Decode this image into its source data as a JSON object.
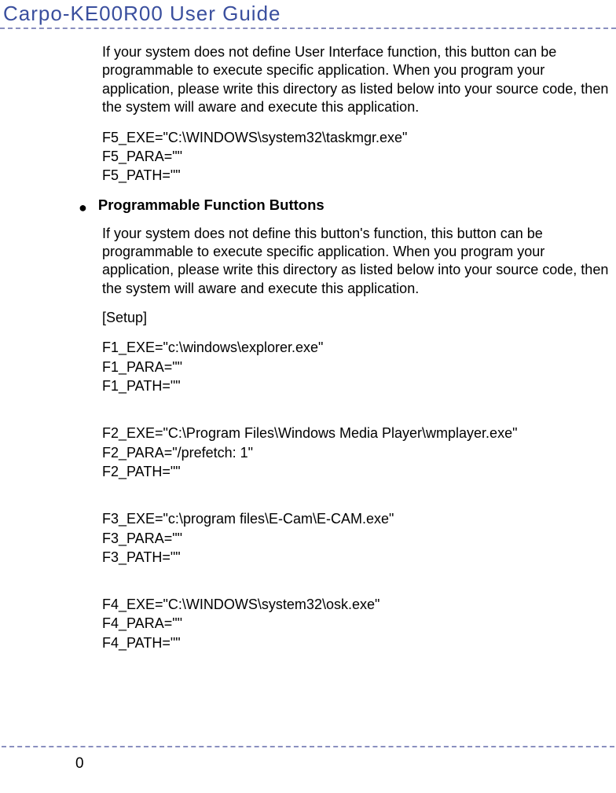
{
  "title": "Carpo-KE00R00  User  Guide",
  "intro_para": "If your system does not define User Interface function, this button can be programmable to execute specific application. When you program your application, please write this directory as listed below into your source code, then the system will aware and execute this application.",
  "f5": {
    "exe": "F5_EXE=\"C:\\WINDOWS\\system32\\taskmgr.exe\"",
    "para": "F5_PARA=\"\"",
    "path": "F5_PATH=\"\""
  },
  "bullet_heading": "Programmable Function Buttons",
  "bullet_para": "If your system does not define this button's function, this button can be programmable to execute specific application. When you program your application, please write this directory as listed below into your source code, then the system will aware and execute this application.",
  "setup_label": "[Setup]",
  "f1": {
    "exe": "F1_EXE=\"c:\\windows\\explorer.exe\"",
    "para": "F1_PARA=\"\"",
    "path": "F1_PATH=\"\""
  },
  "f2": {
    "exe": "F2_EXE=\"C:\\Program Files\\Windows Media Player\\wmplayer.exe\"",
    "para": "F2_PARA=\"/prefetch: 1\"",
    "path": "F2_PATH=\"\""
  },
  "f3": {
    "exe": "F3_EXE=\"c:\\program files\\E-Cam\\E-CAM.exe\"",
    "para": "F3_PARA=\"\"",
    "path": "F3_PATH=\"\""
  },
  "f4": {
    "exe": "F4_EXE=\"C:\\WINDOWS\\system32\\osk.exe\"",
    "para": "F4_PARA=\"\"",
    "path": "F4_PATH=\"\""
  },
  "page_number": "0"
}
